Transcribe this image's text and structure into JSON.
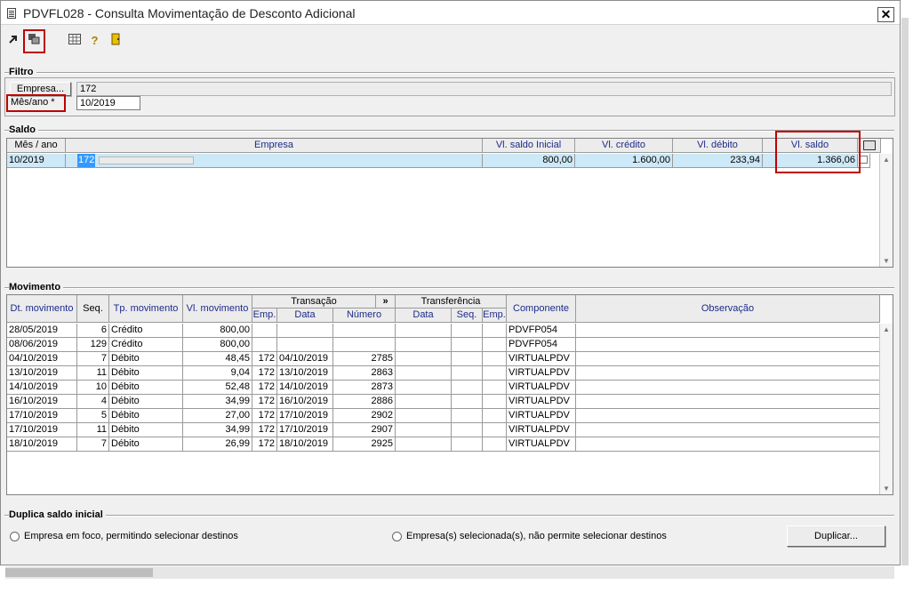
{
  "window": {
    "title": "PDVFL028 - Consulta Movimentação de Desconto Adicional",
    "close_label": "✕"
  },
  "toolbar": {
    "icons": [
      "export-icon",
      "windows-icon",
      "grid-icon",
      "help-icon",
      "exit-door-icon"
    ]
  },
  "filtro": {
    "group_label": "Filtro",
    "empresa_button": "Empresa...",
    "empresa_value": "172",
    "mesano_label": "Mês/ano *",
    "mesano_value": "10/2019"
  },
  "saldo": {
    "group_label": "Saldo",
    "headers": {
      "mes_ano": "Mês / ano",
      "empresa": "Empresa",
      "saldo_inicial": "Vl. saldo Inicial",
      "credito": "Vl. crédito",
      "debito": "Vl. débito",
      "saldo": "Vl. saldo"
    },
    "rows": [
      {
        "mes_ano": "10/2019",
        "empresa_code": "172",
        "saldo_inicial": "800,00",
        "credito": "1.600,00",
        "debito": "233,94",
        "saldo": "1.366,06"
      }
    ]
  },
  "movimento": {
    "group_label": "Movimento",
    "headers": {
      "dt": "Dt. movimento",
      "seq": "Seq.",
      "tp": "Tp. movimento",
      "vl": "Vl. movimento",
      "transacao": "Transação",
      "expand": "»",
      "transferencia": "Transferência",
      "emp": "Emp.",
      "data": "Data",
      "numero": "Número",
      "tdata": "Data",
      "tseq": "Seq.",
      "temp": "Emp.",
      "componente": "Componente",
      "observacao": "Observação"
    },
    "rows": [
      {
        "dt": "28/05/2019",
        "seq": "6",
        "tp": "Crédito",
        "vl": "800,00",
        "emp": "",
        "data": "",
        "numero": "",
        "comp": "PDVFP054"
      },
      {
        "dt": "08/06/2019",
        "seq": "129",
        "tp": "Crédito",
        "vl": "800,00",
        "emp": "",
        "data": "",
        "numero": "",
        "comp": "PDVFP054"
      },
      {
        "dt": "04/10/2019",
        "seq": "7",
        "tp": "Débito",
        "vl": "48,45",
        "emp": "172",
        "data": "04/10/2019",
        "numero": "2785",
        "comp": "VIRTUALPDV"
      },
      {
        "dt": "13/10/2019",
        "seq": "11",
        "tp": "Débito",
        "vl": "9,04",
        "emp": "172",
        "data": "13/10/2019",
        "numero": "2863",
        "comp": "VIRTUALPDV"
      },
      {
        "dt": "14/10/2019",
        "seq": "10",
        "tp": "Débito",
        "vl": "52,48",
        "emp": "172",
        "data": "14/10/2019",
        "numero": "2873",
        "comp": "VIRTUALPDV"
      },
      {
        "dt": "16/10/2019",
        "seq": "4",
        "tp": "Débito",
        "vl": "34,99",
        "emp": "172",
        "data": "16/10/2019",
        "numero": "2886",
        "comp": "VIRTUALPDV"
      },
      {
        "dt": "17/10/2019",
        "seq": "5",
        "tp": "Débito",
        "vl": "27,00",
        "emp": "172",
        "data": "17/10/2019",
        "numero": "2902",
        "comp": "VIRTUALPDV"
      },
      {
        "dt": "17/10/2019",
        "seq": "11",
        "tp": "Débito",
        "vl": "34,99",
        "emp": "172",
        "data": "17/10/2019",
        "numero": "2907",
        "comp": "VIRTUALPDV"
      },
      {
        "dt": "18/10/2019",
        "seq": "7",
        "tp": "Débito",
        "vl": "26,99",
        "emp": "172",
        "data": "18/10/2019",
        "numero": "2925",
        "comp": "VIRTUALPDV"
      }
    ]
  },
  "duplica": {
    "group_label": "Duplica saldo inicial",
    "option1": "Empresa em foco, permitindo selecionar destinos",
    "option2": "Empresa(s) selecionada(s), não permite selecionar destinos",
    "button": "Duplicar..."
  },
  "colors": {
    "highlight": "#c00000",
    "header_text": "#1e2a8a",
    "selected_row": "#cde8f6",
    "selection": "#3399ff"
  }
}
